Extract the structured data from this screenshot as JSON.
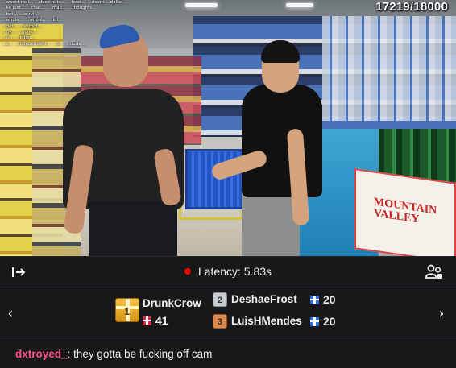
{
  "stream": {
    "viewer_count": "17219/18000",
    "overlay_chat": [
      "…wasnt real…  …deez nuts…  …fowk… …dasnt  …dollar…",
      "…ke just… …chat… …Imao… …thoughts…",
      "…bet… …is rvl…",
      "…whole… …whole… …lol…",
      "…get… …stupid…",
      "…fly… …gone…",
      "…is… …edge…",
      "…s… …independent… …a… …dude…"
    ],
    "sign_text": "MOUNTAIN VALLEY"
  },
  "controls": {
    "latency_label": "Latency:",
    "latency_value": "5.83s"
  },
  "leaderboard": {
    "first": {
      "rank": "1",
      "name": "DrunkCrow",
      "count": "41"
    },
    "second": {
      "rank": "2",
      "name": "DeshaeFrost",
      "count": "20"
    },
    "third": {
      "rank": "3",
      "name": "LuisHMendes",
      "count": "20"
    }
  },
  "chat": {
    "username": "dxtroyed_",
    "separator": ":",
    "message": "they gotta be fucking off cam"
  },
  "colors": {
    "background": "#18181b",
    "latency_dot": "#eb0400",
    "chat_username": "#ff4f8a",
    "gift_gold": "#f6c343",
    "gift_red": "#e0263b",
    "gift_blue": "#2f6fe0"
  },
  "icons": {
    "collapse": "collapse-arrow-icon",
    "community": "community-icon",
    "prev": "chevron-left-icon",
    "next": "chevron-right-icon",
    "gift": "gift-icon"
  }
}
